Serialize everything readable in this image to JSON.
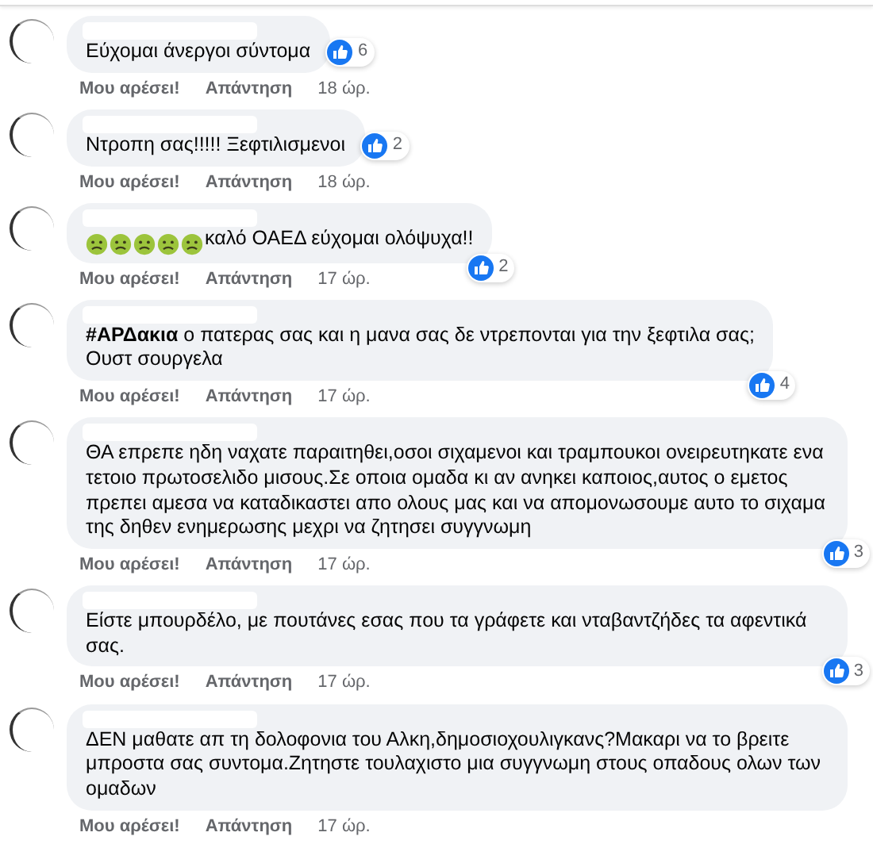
{
  "comments": [
    {
      "kind": "short",
      "text": "Εύχομαι άνεργοι σύντομα",
      "likes": "6",
      "like_label": "Μου αρέσει!",
      "reply_label": "Απάντηση",
      "time": "18 ώρ."
    },
    {
      "kind": "short",
      "text": "Ντροπη σας!!!!! Ξεφτιλισμενοι",
      "likes": "2",
      "like_label": "Μου αρέσει!",
      "reply_label": "Απάντηση",
      "time": "18 ώρ."
    },
    {
      "kind": "emoji",
      "text": "καλό ΟΑΕΔ εύχομαι ολόψυχα!!",
      "likes": "2",
      "like_label": "Μου αρέσει!",
      "reply_label": "Απάντηση",
      "time": "17 ώρ."
    },
    {
      "kind": "plain",
      "text": "**#ΑΡΔακια** ο πατερας σας και η μανα σας δε ντρεπονται για την ξεφτιλα σας;\nΟυστ σουργελα",
      "likes": "4",
      "like_label": "Μου αρέσει!",
      "reply_label": "Απάντηση",
      "time": "17 ώρ."
    },
    {
      "kind": "plain",
      "text": "ΘΑ επρεπε ηδη ναχατε παραιτηθει,οσοι σιχαμενοι και τραμπουκοι ονειρευτηκατε ενα τετοιο πρωτοσελιδο μισους.Σε οποια ομαδα κι αν ανηκει καποιος,αυτος ο εμετος πρεπει αμεσα να καταδικαστει απο ολους μας και να απομονωσουμε αυτο το σιχαμα της δηθεν ενημερωσης μεχρι να ζητησει συγγνωμη",
      "likes": "3",
      "like_label": "Μου αρέσει!",
      "reply_label": "Απάντηση",
      "time": "17 ώρ."
    },
    {
      "kind": "plain",
      "text": "Είστε μπουρδέλο, με πουτάνες εσας που τα γράφετε και νταβαντζήδες τα αφεντικά σας.",
      "likes": "3",
      "like_label": "Μου αρέσει!",
      "reply_label": "Απάντηση",
      "time": "17 ώρ."
    },
    {
      "kind": "plain",
      "text": "ΔΕΝ μαθατε απ τη δολοφονια του Αλκη,δημοσιοχουλιγκανς?Μακαρι να το βρειτε μπροστα σας συντομα.Ζητηστε τουλαχιστο μια συγγνωμη στους οπαδους ολων των ομαδων",
      "like_label": "Μου αρέσει!",
      "reply_label": "Απάντηση",
      "time": "17 ώρ."
    }
  ]
}
